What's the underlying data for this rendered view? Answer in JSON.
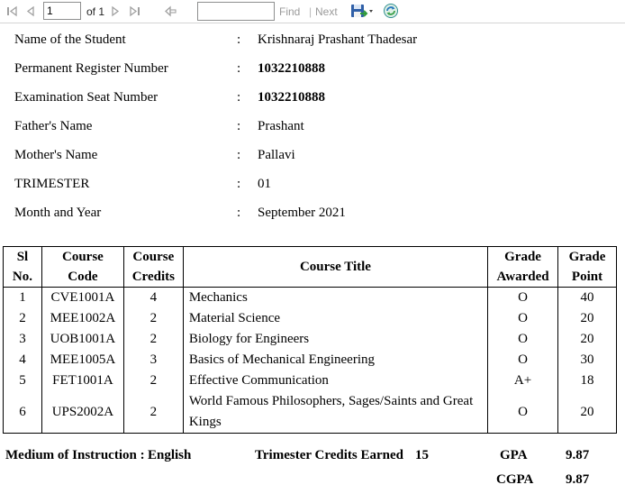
{
  "toolbar": {
    "page_value": "1",
    "of_label": "of 1",
    "find_label": "Find",
    "separator": "|",
    "next_label": "Next"
  },
  "student": [
    {
      "label": "Name of the Student",
      "value": "Krishnaraj Prashant Thadesar",
      "bold": false
    },
    {
      "label": "Permanent Register Number",
      "value": "1032210888",
      "bold": true
    },
    {
      "label": "Examination Seat Number",
      "value": "1032210888",
      "bold": true
    },
    {
      "label": "Father's Name",
      "value": "Prashant",
      "bold": false
    },
    {
      "label": "Mother's Name",
      "value": "Pallavi",
      "bold": false
    },
    {
      "label": "TRIMESTER",
      "value": "01",
      "bold": false
    },
    {
      "label": "Month and Year",
      "value": "September 2021",
      "bold": false
    }
  ],
  "colon": ":",
  "table": {
    "headers": {
      "sl_1": "Sl",
      "sl_2": "No.",
      "code_1": "Course",
      "code_2": "Code",
      "credits_1": "Course",
      "credits_2": "Credits",
      "title": "Course Title",
      "grade_1": "Grade",
      "grade_2": "Awarded",
      "point_1": "Grade",
      "point_2": "Point"
    },
    "rows": [
      {
        "sl": "1",
        "code": "CVE1001A",
        "credits": "4",
        "title": "Mechanics",
        "grade": "O",
        "point": "40"
      },
      {
        "sl": "2",
        "code": "MEE1002A",
        "credits": "2",
        "title": "Material Science",
        "grade": "O",
        "point": "20"
      },
      {
        "sl": "3",
        "code": "UOB1001A",
        "credits": "2",
        "title": "Biology for Engineers",
        "grade": "O",
        "point": "20"
      },
      {
        "sl": "4",
        "code": "MEE1005A",
        "credits": "3",
        "title": "Basics of Mechanical Engineering",
        "grade": "O",
        "point": "30"
      },
      {
        "sl": "5",
        "code": "FET1001A",
        "credits": "2",
        "title": "Effective Communication",
        "grade": "A+",
        "point": "18"
      },
      {
        "sl": "6",
        "code": "UPS2002A",
        "credits": "2",
        "title": "World Famous Philosophers, Sages/Saints and Great Kings",
        "grade": "O",
        "point": "20"
      }
    ]
  },
  "footer": {
    "medium_label": "Medium of Instruction :",
    "medium_value": "English",
    "credits_label": "Trimester Credits Earned",
    "credits_value": "15",
    "gpa_label": "GPA",
    "gpa_value": "9.87",
    "cgpa_label": "CGPA",
    "cgpa_value": "9.87"
  }
}
